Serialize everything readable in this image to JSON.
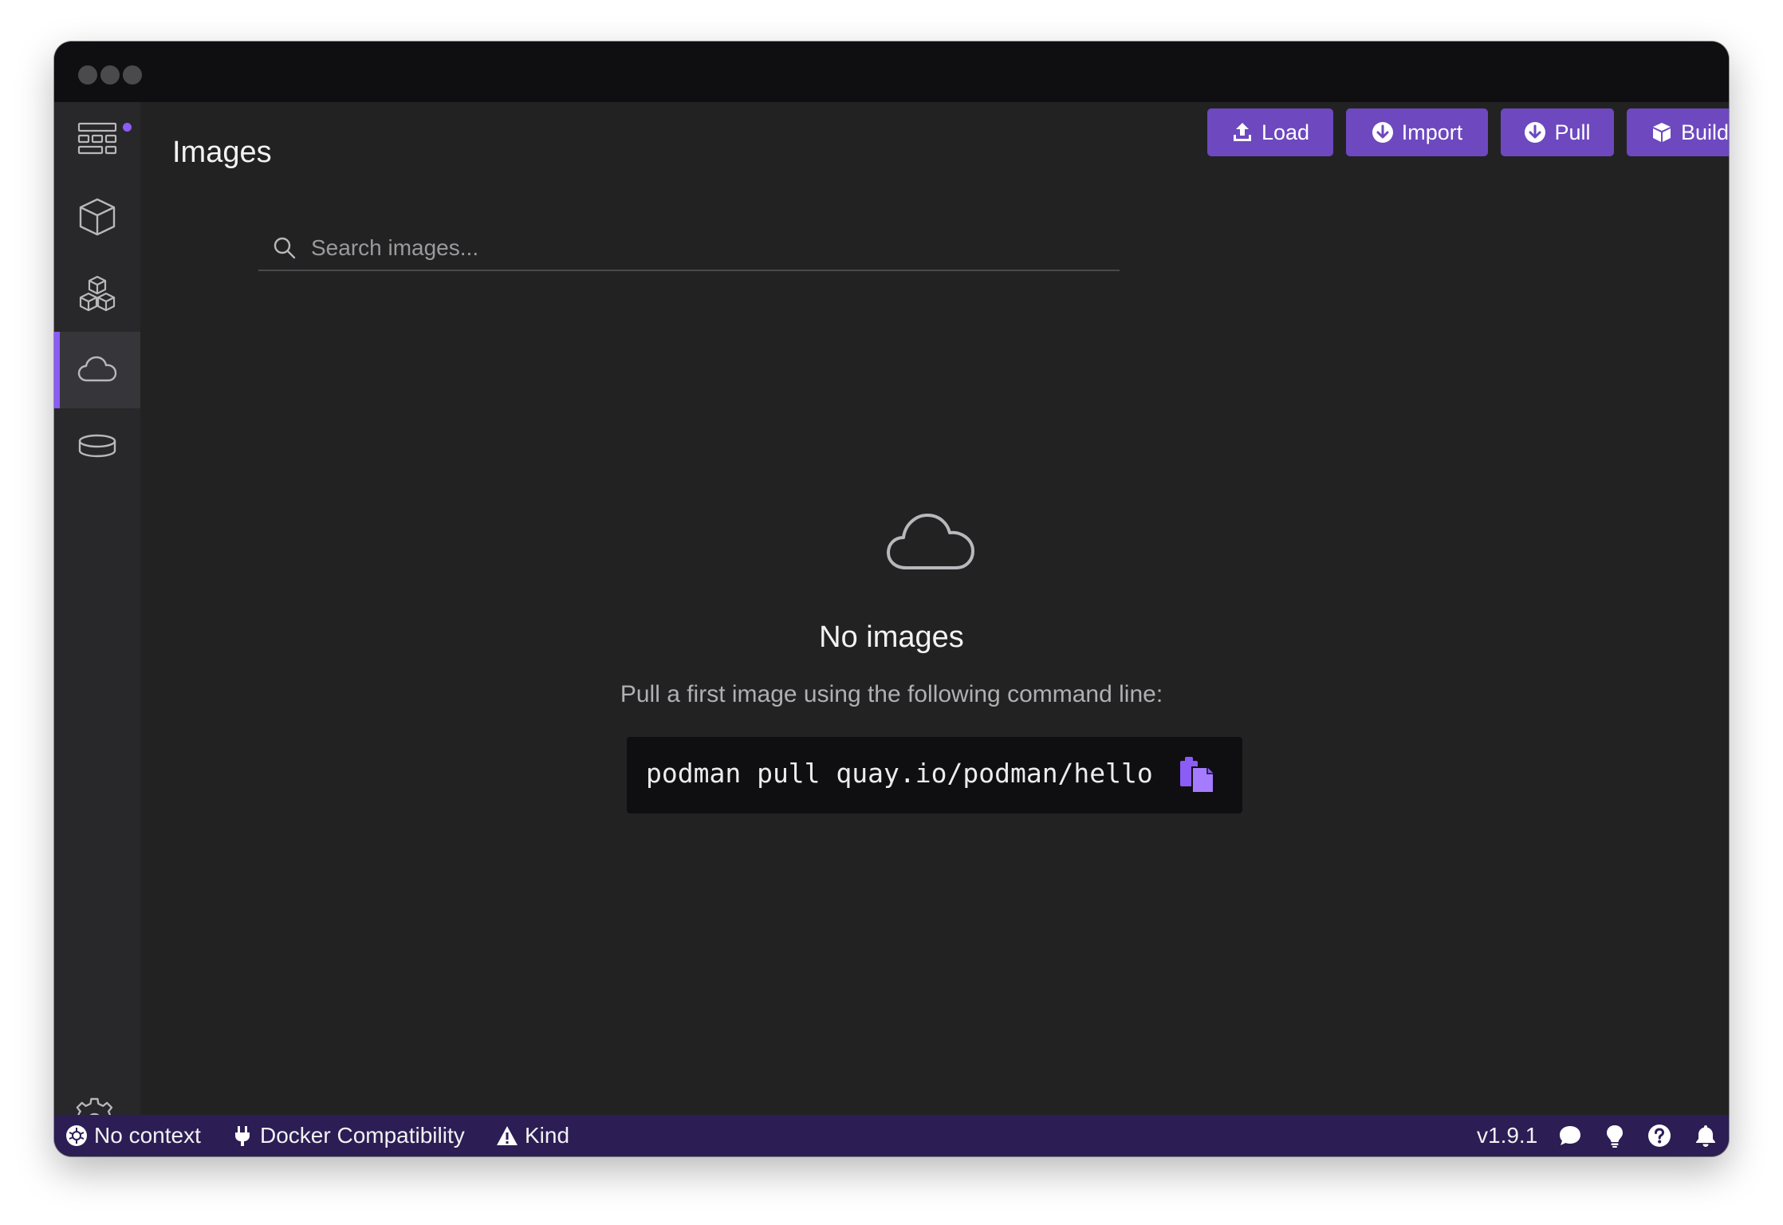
{
  "window": {
    "controls": [
      "close",
      "minimize",
      "maximize"
    ]
  },
  "sidebar": {
    "items": [
      {
        "id": "dashboard",
        "icon": "dashboard-icon"
      },
      {
        "id": "containers",
        "icon": "cube-icon"
      },
      {
        "id": "pods",
        "icon": "cubes-icon"
      },
      {
        "id": "images",
        "icon": "cloud-icon",
        "active": true
      },
      {
        "id": "volumes",
        "icon": "volume-icon"
      }
    ],
    "settings_icon": "gear-icon"
  },
  "header": {
    "title": "Images",
    "buttons": {
      "load": "Load",
      "import": "Import",
      "pull": "Pull",
      "build": "Build"
    }
  },
  "search": {
    "placeholder": "Search images..."
  },
  "empty_state": {
    "icon": "cloud-icon",
    "title": "No images",
    "message": "Pull a first image using the following command line:",
    "command": "podman pull quay.io/podman/hello"
  },
  "statusbar": {
    "context": "No context",
    "docker": "Docker Compatibility",
    "kind": "Kind",
    "version": "v1.9.1"
  },
  "colors": {
    "accent": "#6d48bf",
    "accent_bright": "#8b5cf6",
    "statusbar": "#2c1d55",
    "background": "#222222",
    "sidebar": "#28282a",
    "titlebar": "#0f0f11"
  }
}
